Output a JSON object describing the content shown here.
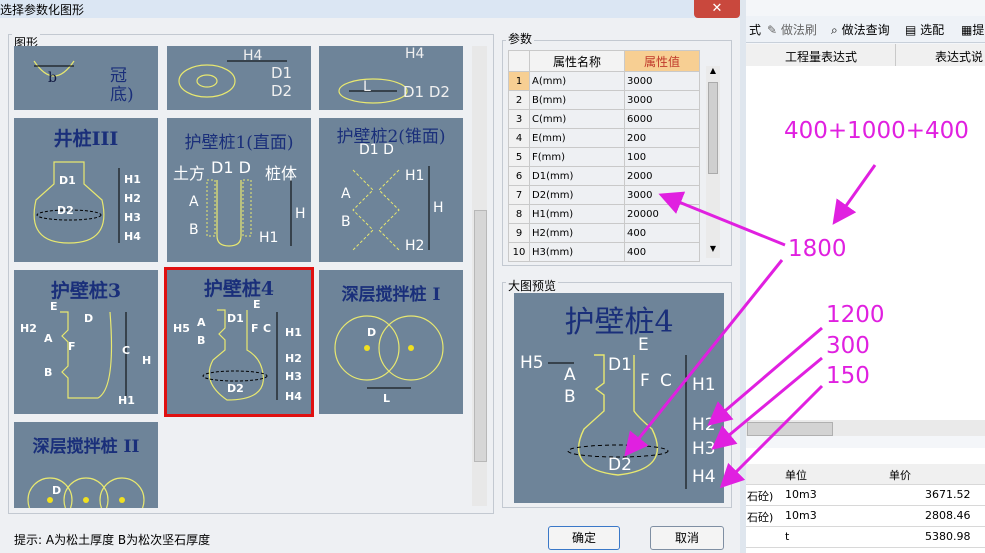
{
  "window": {
    "title": "选择参数化图形",
    "close_glyph": "✕"
  },
  "graph_group": {
    "label": "图形"
  },
  "tiles": [
    {
      "id": "partial-1",
      "title": "",
      "labels": [
        "b",
        "冠",
        "底)"
      ]
    },
    {
      "id": "partial-2",
      "title": "",
      "labels": [
        "H4",
        "D1",
        "D2"
      ]
    },
    {
      "id": "partial-3",
      "title": "",
      "labels": [
        "H4",
        "L",
        "D1 D2"
      ]
    },
    {
      "id": "jingzhuang-3",
      "title": "井桩III",
      "labels": [
        "D1",
        "D2",
        "H1",
        "H2",
        "H3",
        "H4"
      ]
    },
    {
      "id": "hubizhuang-1",
      "title": "护壁桩1(直面)",
      "labels": [
        "土方",
        "D1 D",
        "桩体",
        "A",
        "B",
        "H1",
        "H"
      ]
    },
    {
      "id": "hubizhuang-2",
      "title": "护壁桩2(锥面)",
      "labels": [
        "D1 D",
        "H1",
        "A",
        "B",
        "H",
        "H2"
      ]
    },
    {
      "id": "hubizhuang-3",
      "title": "护壁桩3",
      "labels": [
        "E",
        "D",
        "H2",
        "A",
        "F",
        "C",
        "H",
        "B",
        "H1"
      ]
    },
    {
      "id": "hubizhuang-4",
      "title": "护壁桩4",
      "labels": [
        "E",
        "H5",
        "A",
        "D1",
        "F",
        "C",
        "H1",
        "B",
        "H2",
        "H3",
        "D2",
        "H4"
      ]
    },
    {
      "id": "shenceng-1",
      "title": "深层搅拌桩 I",
      "labels": [
        "D",
        "L"
      ]
    },
    {
      "id": "shenceng-2",
      "title": "深层搅拌桩 II",
      "labels": [
        "D"
      ]
    }
  ],
  "params": {
    "label": "参数",
    "headers": [
      "属性名称",
      "属性值"
    ],
    "rows": [
      {
        "idx": "1",
        "name": "A(mm)",
        "value": "3000"
      },
      {
        "idx": "2",
        "name": "B(mm)",
        "value": "3000"
      },
      {
        "idx": "3",
        "name": "C(mm)",
        "value": "6000"
      },
      {
        "idx": "4",
        "name": "E(mm)",
        "value": "200"
      },
      {
        "idx": "5",
        "name": "F(mm)",
        "value": "100"
      },
      {
        "idx": "6",
        "name": "D1(mm)",
        "value": "2000"
      },
      {
        "idx": "7",
        "name": "D2(mm)",
        "value": "3000"
      },
      {
        "idx": "8",
        "name": "H1(mm)",
        "value": "20000"
      },
      {
        "idx": "9",
        "name": "H2(mm)",
        "value": "400"
      },
      {
        "idx": "10",
        "name": "H3(mm)",
        "value": "400"
      }
    ]
  },
  "preview": {
    "label": "大图预览",
    "title": "护壁桩4",
    "labels": [
      "H5",
      "E",
      "A",
      "D1",
      "F",
      "C",
      "H1",
      "B",
      "H2",
      "H3",
      "D2",
      "H4"
    ]
  },
  "hint": "提示: A为松土厚度  B为松次坚石厚度",
  "buttons": {
    "ok": "确定",
    "cancel": "取消"
  },
  "annotations": [
    "400+1000+400",
    "1800",
    "1200",
    "300",
    "150"
  ],
  "background_app": {
    "toolbar": [
      "式",
      "做法刷",
      "做法查询",
      "选配",
      "提"
    ],
    "upper_headers": [
      "工程量表达式",
      "表达式说"
    ],
    "lower_headers": [
      "单位",
      "单价"
    ],
    "lower_rows": [
      {
        "name": "石砼)",
        "unit": "10m3",
        "price": "3671.52"
      },
      {
        "name": "石砼)",
        "unit": "10m3",
        "price": "2808.46"
      },
      {
        "name": "",
        "unit": "t",
        "price": "5380.98"
      }
    ]
  },
  "colors": {
    "tile_bg": "#6e8499",
    "tile_title": "#1a2f7a",
    "selected_border": "#e01010",
    "annotation": "#e020e0",
    "header_highlight": "#f7cf93"
  }
}
